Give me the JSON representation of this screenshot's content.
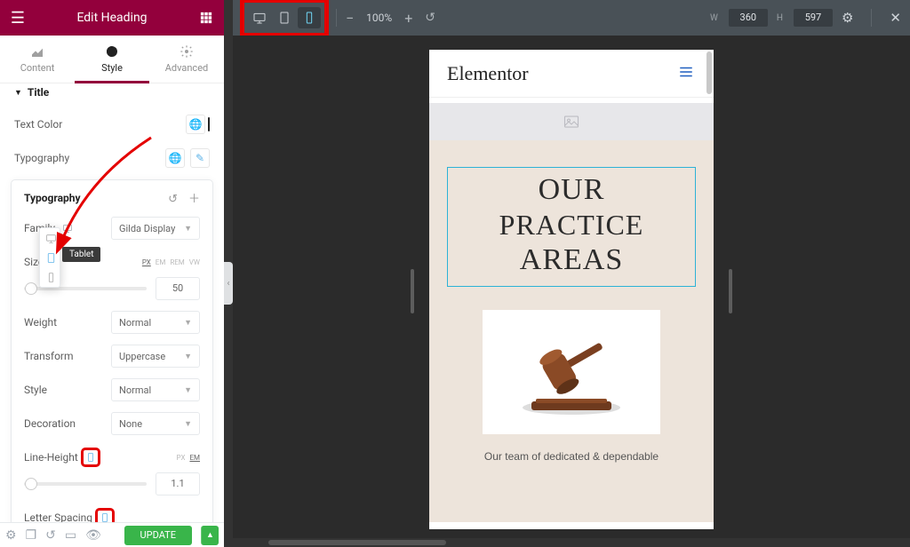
{
  "panel": {
    "title": "Edit Heading",
    "tabs": {
      "content": "Content",
      "style": "Style",
      "advanced": "Advanced",
      "active": "style"
    },
    "section_title": "Title",
    "text_color": {
      "label": "Text Color",
      "color": "#2e2e2e"
    },
    "typography_row": {
      "label": "Typography"
    },
    "popover": {
      "title": "Typography",
      "family": {
        "label": "Family",
        "value": "Gilda Display"
      },
      "size": {
        "label": "Size",
        "value": "50",
        "units": [
          "PX",
          "EM",
          "REM",
          "VW"
        ],
        "active_unit": "PX"
      },
      "weight": {
        "label": "Weight",
        "value": "Normal"
      },
      "transform": {
        "label": "Transform",
        "value": "Uppercase"
      },
      "style": {
        "label": "Style",
        "value": "Normal"
      },
      "decoration": {
        "label": "Decoration",
        "value": "None"
      },
      "line_height": {
        "label": "Line-Height",
        "value": "1.1",
        "units": [
          "PX",
          "EM"
        ],
        "active_unit": "EM"
      },
      "letter_spacing": {
        "label": "Letter Spacing"
      },
      "responsive_tooltip": "Tablet"
    },
    "update_label": "UPDATE"
  },
  "topbar": {
    "zoom": "100%",
    "width_label": "W",
    "width": "360",
    "height_label": "H",
    "height": "597"
  },
  "preview": {
    "logo": "Elementor",
    "heading": {
      "l1": "OUR",
      "l2": "PRACTICE",
      "l3": "AREAS"
    },
    "tagline": "Our team of dedicated & dependable"
  }
}
